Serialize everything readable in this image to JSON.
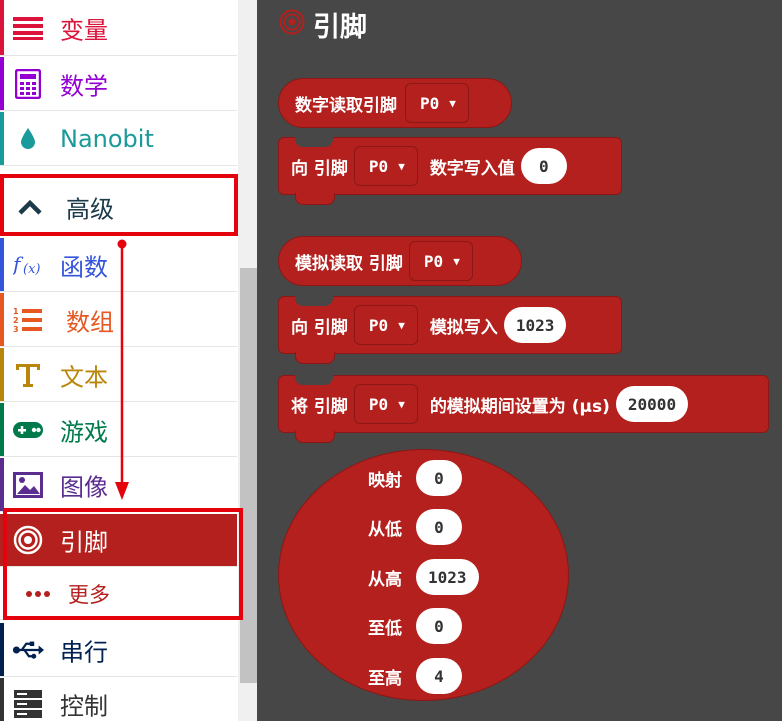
{
  "toolbox": {
    "categories": [
      {
        "label": "变量",
        "color": "#dc143c",
        "icon": "variable-icon"
      },
      {
        "label": "数学",
        "color": "#9400d3",
        "icon": "calculator-icon"
      },
      {
        "label": "Nanobit",
        "color": "#1a9a9a",
        "icon": "drop-icon"
      },
      {
        "label": "高级",
        "color": "#1b3a4a",
        "icon": "chevron-up-icon"
      },
      {
        "label": "函数",
        "color": "#3455db",
        "icon": "function-icon"
      },
      {
        "label": "数组",
        "color": "#e65722",
        "icon": "list-icon"
      },
      {
        "label": "文本",
        "color": "#b8860b",
        "icon": "text-icon"
      },
      {
        "label": "游戏",
        "color": "#007a4b",
        "icon": "gamepad-icon"
      },
      {
        "label": "图像",
        "color": "#5c2d91",
        "icon": "image-icon"
      },
      {
        "label": "引脚",
        "color": "#b3201d",
        "icon": "pin-icon"
      },
      {
        "label": "更多",
        "color": "#b3201d",
        "icon": "more-icon"
      },
      {
        "label": "串行",
        "color": "#002050",
        "icon": "usb-icon"
      },
      {
        "label": "控制",
        "color": "#333333",
        "icon": "server-icon"
      }
    ]
  },
  "workspace": {
    "title": "引脚",
    "blocks": {
      "digital_read": {
        "text": "数字读取引脚",
        "pin": "P0"
      },
      "digital_write": {
        "text1": "向 引脚",
        "pin": "P0",
        "text2": "数字写入值",
        "value": "0"
      },
      "analog_read": {
        "text1": "模拟读取 引脚",
        "pin": "P0"
      },
      "analog_write": {
        "text1": "向 引脚",
        "pin": "P0",
        "text2": "模拟写入",
        "value": "1023"
      },
      "analog_period": {
        "text1": "将 引脚",
        "pin": "P0",
        "text2": "的模拟期间设置为 (μs)",
        "value": "20000"
      },
      "map": {
        "rows": [
          {
            "label": "映射",
            "value": "0"
          },
          {
            "label": "从低",
            "value": "0"
          },
          {
            "label": "从高",
            "value": "1023"
          },
          {
            "label": "至低",
            "value": "0"
          },
          {
            "label": "至高",
            "value": "4"
          }
        ]
      }
    }
  },
  "colors": {
    "pins_accent": "#b3201d",
    "highlight": "#e4030d",
    "workspace_bg": "#474747"
  }
}
